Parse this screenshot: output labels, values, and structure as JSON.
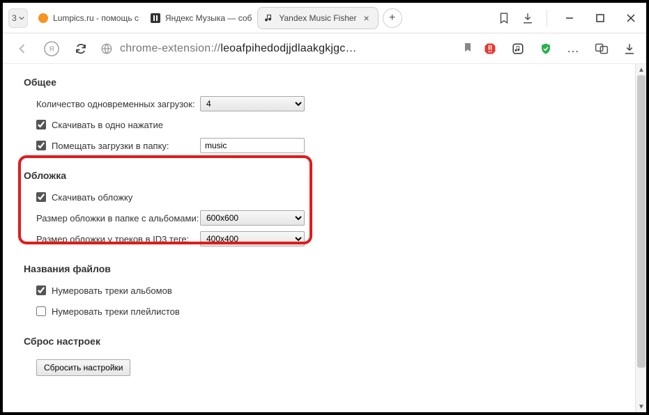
{
  "titlebar": {
    "pinned_count": "3",
    "tabs": [
      {
        "label": "Lumpics.ru - помощь с"
      },
      {
        "label": "Яндекс Музыка — соб"
      },
      {
        "label": "Yandex Music Fisher"
      }
    ]
  },
  "url": {
    "scheme": "chrome-extension://",
    "rest": "leoafpihedodjjdlaakgkjgc…"
  },
  "sections": {
    "general": {
      "title": "Общее",
      "downloads_label": "Количество одновременных загрузок:",
      "downloads_value": "4",
      "one_click_label": "Скачивать в одно нажатие",
      "folder_label": "Помещать загрузки в папку:",
      "folder_value": "music"
    },
    "cover": {
      "title": "Обложка",
      "download_cover_label": "Скачивать обложку",
      "album_size_label": "Размер обложки в папке с альбомами:",
      "album_size_value": "600x600",
      "id3_size_label": "Размер обложки у треков в ID3 теге:",
      "id3_size_value": "400x400"
    },
    "filenames": {
      "title": "Названия файлов",
      "number_albums_label": "Нумеровать треки альбомов",
      "number_playlists_label": "Нумеровать треки плейлистов"
    },
    "reset": {
      "title": "Сброс настроек",
      "button_label": "Сбросить настройки"
    }
  }
}
